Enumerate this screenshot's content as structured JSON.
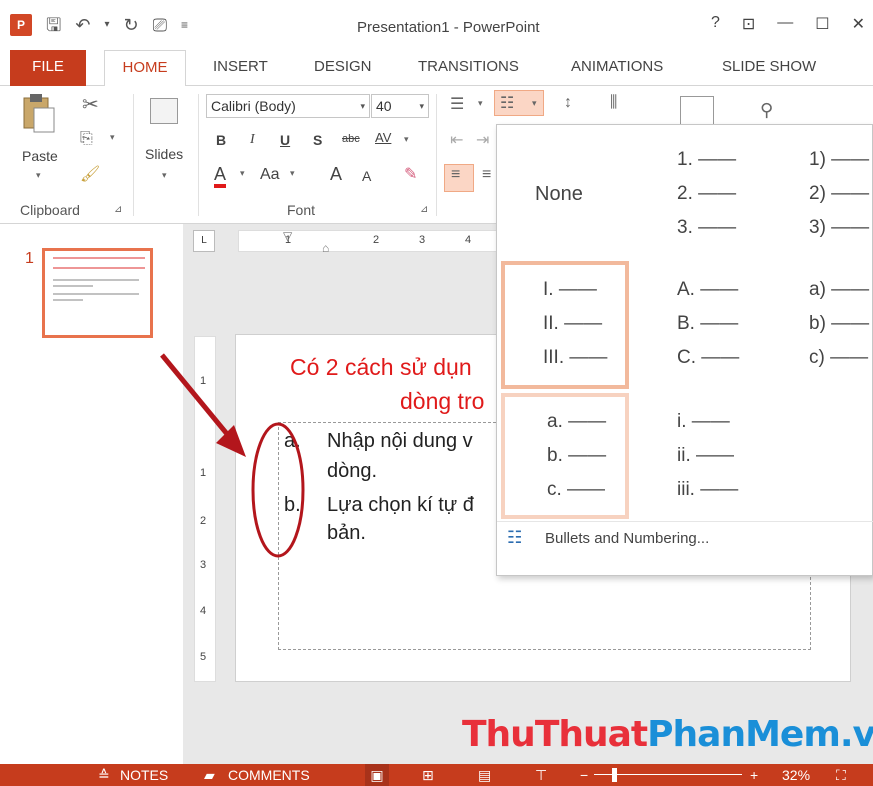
{
  "window": {
    "title": "Presentation1 - PowerPoint",
    "app_icon_text": "P",
    "help": "?",
    "restore_ribbon": "⊡",
    "minimize": "—",
    "maximize": "☐",
    "close": "✕"
  },
  "tabs": [
    "FILE",
    "HOME",
    "INSERT",
    "DESIGN",
    "TRANSITIONS",
    "ANIMATIONS",
    "SLIDE SHOW"
  ],
  "ribbon": {
    "paste_label": "Paste",
    "slides_label": "Slides",
    "clipboard_group": "Clipboard",
    "font_group": "Font",
    "font_name": "Calibri (Body)",
    "font_size": "40",
    "bold": "B",
    "italic": "I",
    "underline": "U",
    "shadow": "S",
    "strike": "abc",
    "spacing": "AV",
    "font_color": "A",
    "change_case": "Aa",
    "grow": "A",
    "shrink": "A"
  },
  "ruler": {
    "corner": "L",
    "h_numbers": [
      "1",
      "2",
      "3",
      "4"
    ],
    "v_numbers": [
      "1",
      "1",
      "2",
      "3",
      "4",
      "5"
    ]
  },
  "thumbnail": {
    "number": "1"
  },
  "slide": {
    "title_line1": "Có 2 cách sử dụn",
    "title_line2": "dòng tro",
    "items": [
      {
        "marker": "a.",
        "line1": "Nhập nội dung v",
        "line2": "dòng."
      },
      {
        "marker": "b.",
        "line1": "Lựa chọn kí tự đ",
        "line2": "bản."
      }
    ]
  },
  "numbering_gallery": {
    "none_label": "None",
    "cells": [
      [
        "1. ——",
        "2. ——",
        "3. ——"
      ],
      [
        "1) ——",
        "2) ——",
        "3) ——"
      ],
      [
        "I. ——",
        "II. ——",
        "III. ——"
      ],
      [
        "A. ——",
        "B. ——",
        "C. ——"
      ],
      [
        "a) ——",
        "b) ——",
        "c) ——"
      ],
      [
        "a. ——",
        "b. ——",
        "c. ——"
      ],
      [
        "i. ——",
        "ii. ——",
        "iii. ——"
      ]
    ],
    "footer_label": "Bullets and Numbering..."
  },
  "statusbar": {
    "notes": "NOTES",
    "comments": "COMMENTS",
    "zoom": "32%"
  },
  "watermark": {
    "part1": "ThuThuat",
    "part2": "PhanMem",
    "part3": ".vn",
    "color1": "#e8303a",
    "color2": "#1a8fd8"
  },
  "colors": {
    "accent": "#c63c1d",
    "title_red": "#e01a1a",
    "annotation": "#b3161c"
  }
}
